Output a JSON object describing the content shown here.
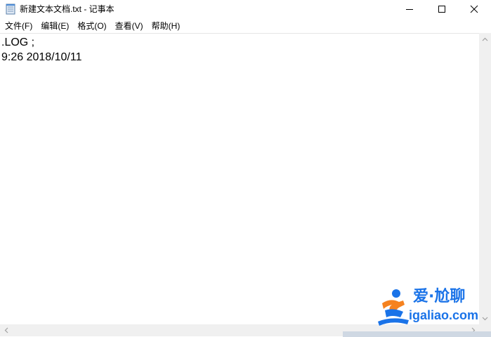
{
  "window": {
    "title": "新建文本文档.txt - 记事本"
  },
  "menu": {
    "items": [
      "文件(F)",
      "编辑(E)",
      "格式(O)",
      "查看(V)",
      "帮助(H)"
    ]
  },
  "editor": {
    "lines": [
      ".LOG ;",
      "9:26 2018/10/11"
    ]
  },
  "watermark": {
    "top_text": "爱·尬聊",
    "bottom_text": "igaliao.com"
  },
  "icons": {
    "app": "notepad-icon",
    "minimize": "minimize-icon",
    "maximize": "maximize-icon",
    "close": "close-icon"
  },
  "colors": {
    "watermark_blue": "#1a73e8",
    "watermark_orange": "#f5821f",
    "scrollbar": "#f0f0f0"
  }
}
